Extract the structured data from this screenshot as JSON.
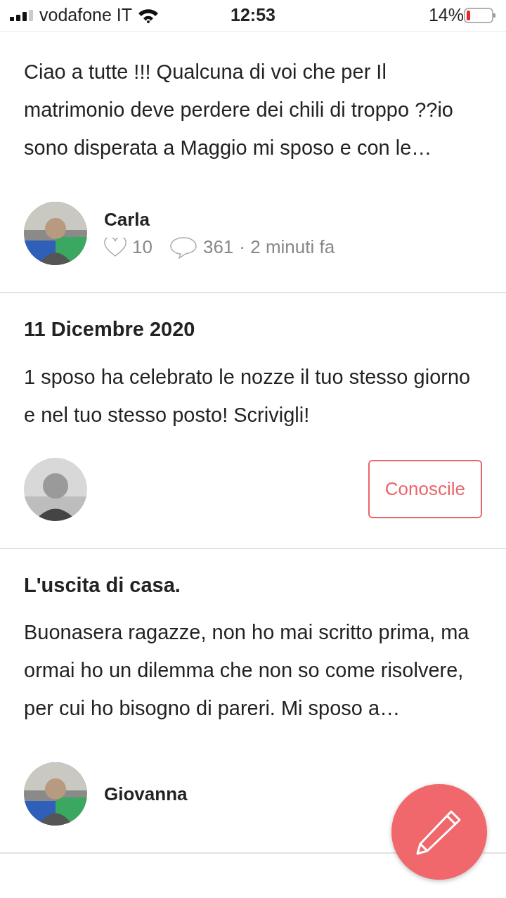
{
  "status_bar": {
    "carrier": "vodafone IT",
    "time": "12:53",
    "battery": "14%"
  },
  "posts": [
    {
      "kind": "discussion",
      "excerpt": "Ciao a tutte !!! Qualcuna di voi che per Il matrimonio deve perdere dei chili di troppo ??io sono disperata a Maggio mi sposo e con le…",
      "author": "Carla",
      "likes": "10",
      "comments": "361",
      "time": "· 2 minuti fa"
    },
    {
      "kind": "match",
      "title": "11 Dicembre 2020",
      "excerpt": "1 sposo ha celebrato le nozze il tuo stesso giorno e nel tuo stesso posto! Scrivigli!",
      "button": "Conoscile"
    },
    {
      "kind": "discussion",
      "title": "L'uscita di casa.",
      "excerpt": "Buonasera ragazze, non ho mai scritto prima, ma ormai ho un dilemma che non so come risolvere, per cui ho bisogno di pareri. Mi sposo a…",
      "author": "Giovanna"
    }
  ]
}
